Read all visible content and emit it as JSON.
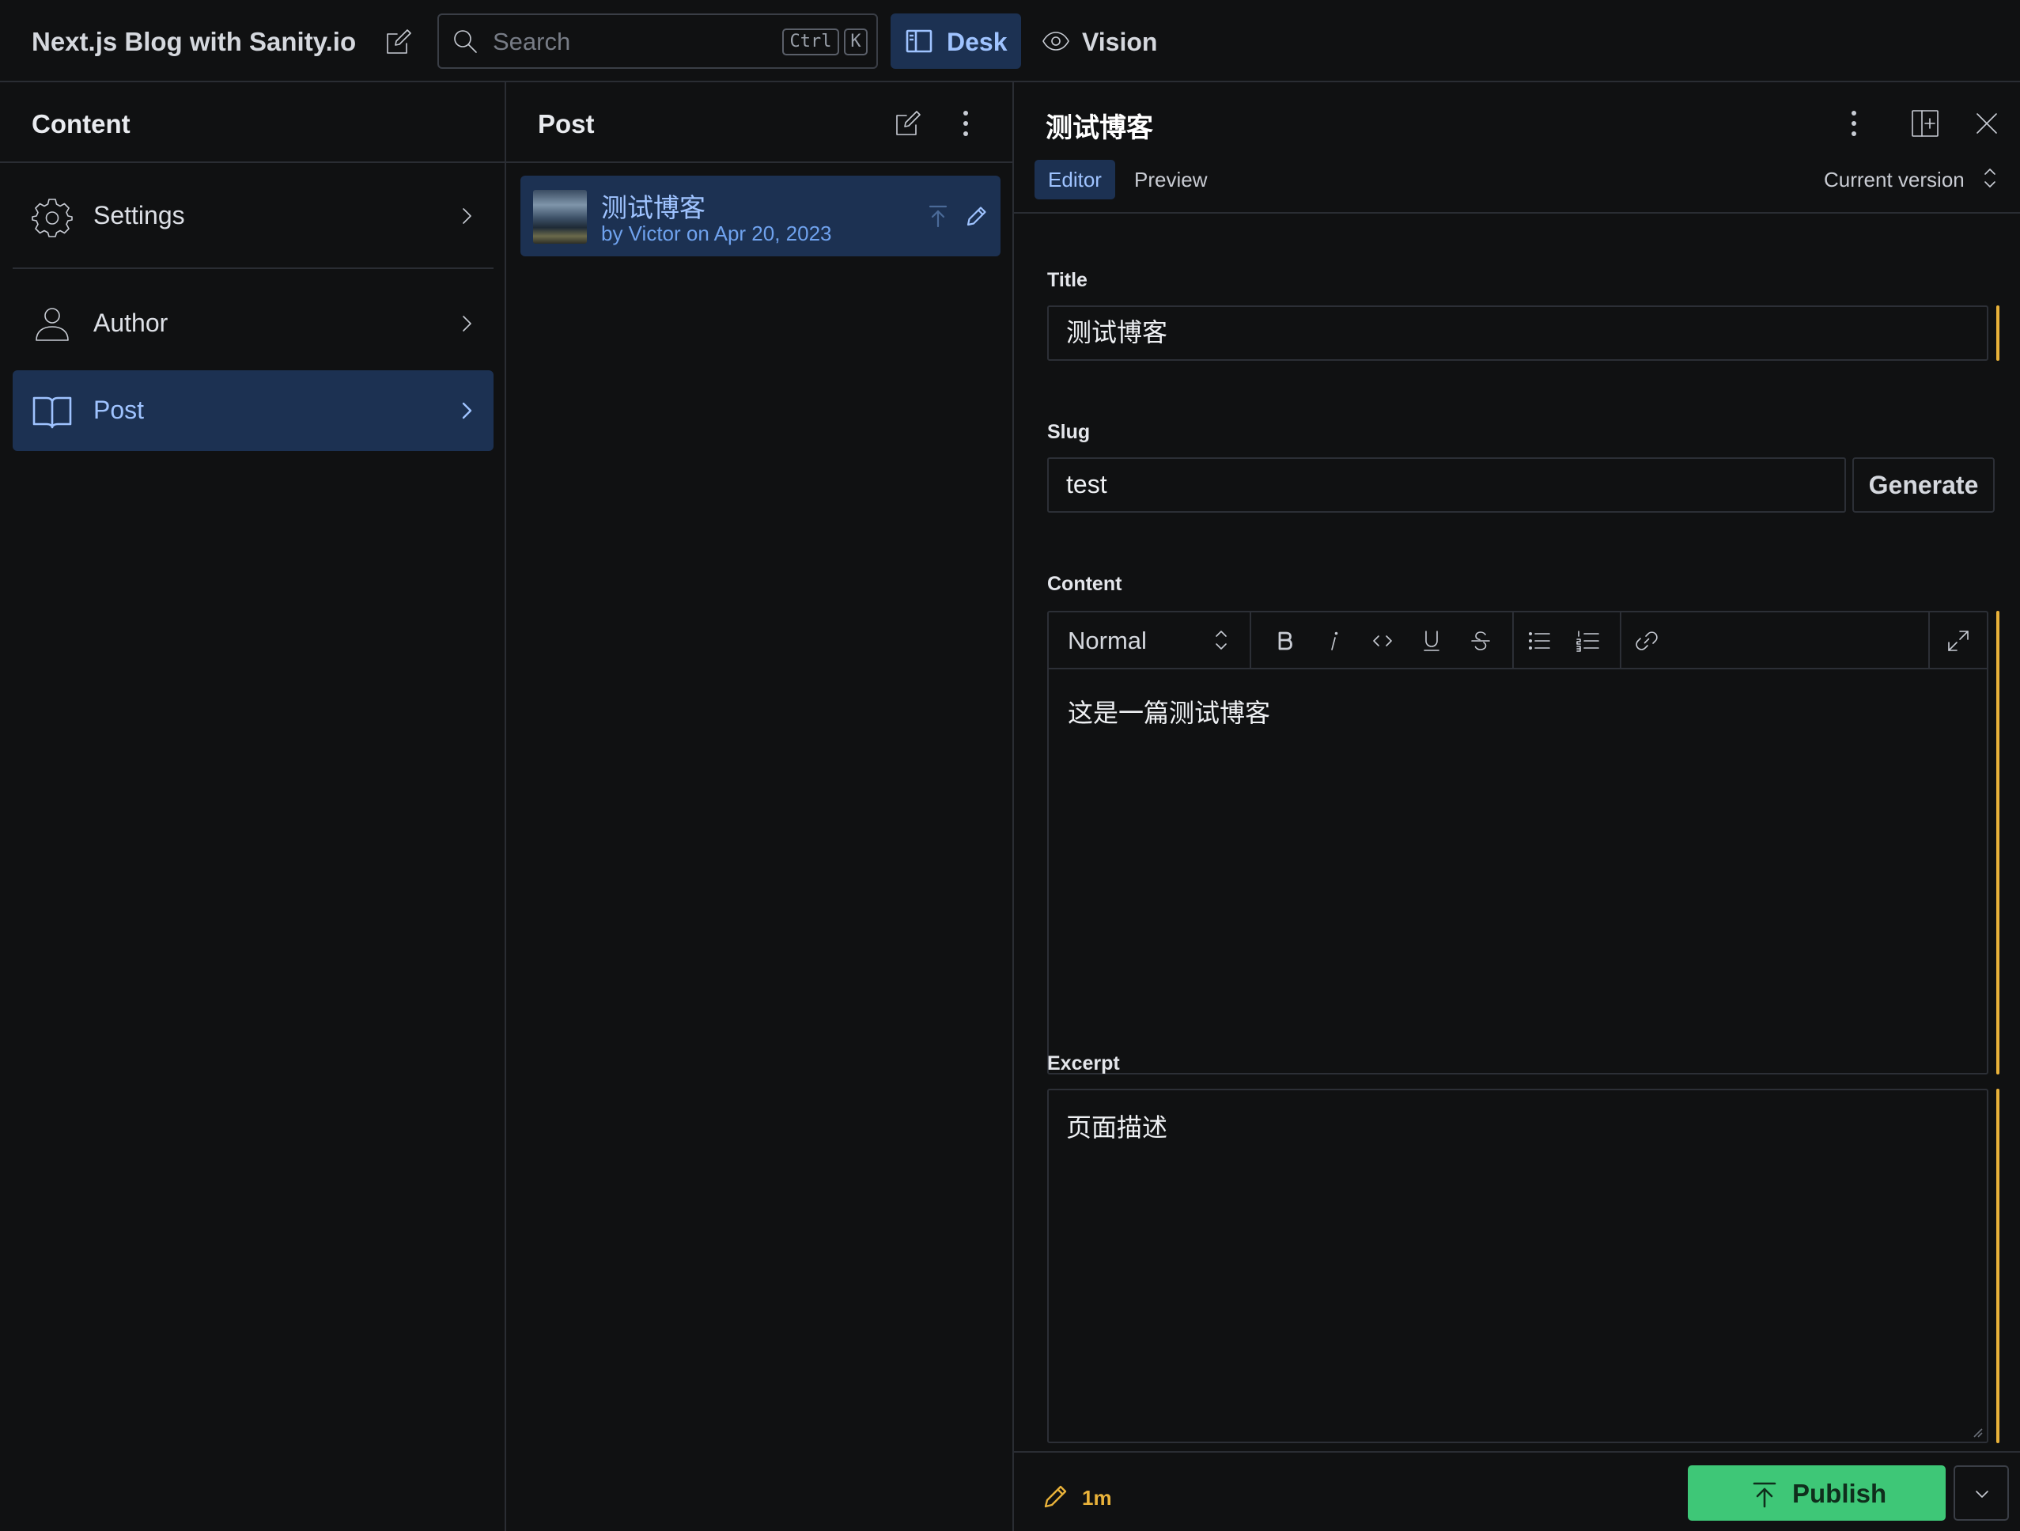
{
  "topbar": {
    "brand": "Next.js Blog with Sanity.io",
    "search": {
      "placeholder": "Search",
      "shortcut_ctrl": "Ctrl",
      "shortcut_key": "K"
    },
    "tabs": [
      {
        "label": "Desk",
        "icon": "desk-icon",
        "active": true
      },
      {
        "label": "Vision",
        "icon": "eye-icon",
        "active": false
      }
    ]
  },
  "content_pane": {
    "title": "Content",
    "items": [
      {
        "label": "Settings",
        "icon": "gear-icon"
      },
      {
        "label": "Author",
        "icon": "user-icon"
      },
      {
        "label": "Post",
        "icon": "book-icon",
        "selected": true
      }
    ]
  },
  "post_pane": {
    "title": "Post",
    "items": [
      {
        "title": "测试博客",
        "subtitle": "by Victor on Apr 20, 2023"
      }
    ]
  },
  "document": {
    "title": "测试博客",
    "tabs": {
      "editor": "Editor",
      "preview": "Preview"
    },
    "version": "Current version",
    "fields": {
      "title": {
        "label": "Title",
        "value": "测试博客"
      },
      "slug": {
        "label": "Slug",
        "value": "test",
        "generate": "Generate"
      },
      "content": {
        "label": "Content",
        "style": "Normal",
        "text": "这是一篇测试博客"
      },
      "excerpt": {
        "label": "Excerpt",
        "value": "页面描述"
      }
    },
    "footer": {
      "edited_ago": "1m",
      "publish": "Publish"
    }
  },
  "colors": {
    "background": "#101112",
    "selected_bg": "#1c3152",
    "accent": "#9fc3ff",
    "changed": "#e9b23a",
    "publish": "#3ec777"
  }
}
